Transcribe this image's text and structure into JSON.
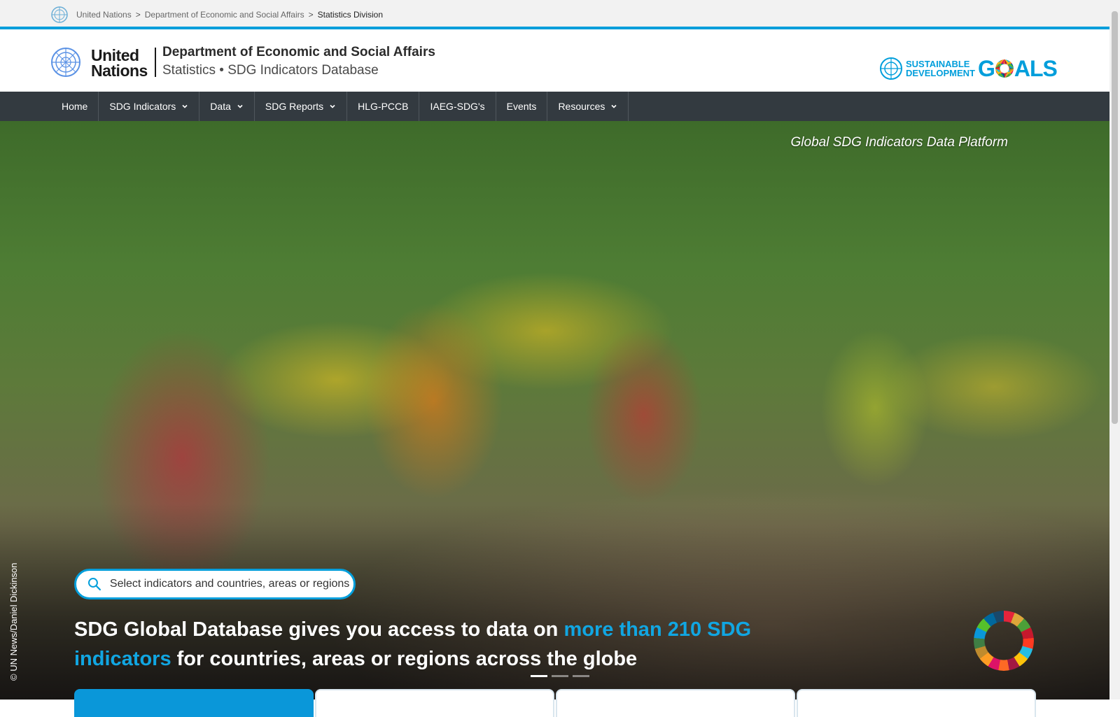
{
  "breadcrumb": {
    "items": [
      "United Nations",
      "Department of Economic and Social Affairs"
    ],
    "current": "Statistics Division",
    "separator": ">"
  },
  "header": {
    "un_word_line1": "United",
    "un_word_line2": "Nations",
    "dept_title": "Department of Economic and Social Affairs",
    "dept_subtitle": "Statistics • SDG Indicators Database",
    "sdg_logo": {
      "line1": "SUSTAINABLE",
      "line2": "DEVELOPMENT",
      "goals_g": "G",
      "goals_rest": "ALS"
    }
  },
  "nav": {
    "items": [
      {
        "label": "Home",
        "dropdown": false
      },
      {
        "label": "SDG Indicators",
        "dropdown": true
      },
      {
        "label": "Data",
        "dropdown": true
      },
      {
        "label": "SDG Reports",
        "dropdown": true
      },
      {
        "label": "HLG-PCCB",
        "dropdown": false
      },
      {
        "label": "IAEG-SDG's",
        "dropdown": false
      },
      {
        "label": "Events",
        "dropdown": false
      },
      {
        "label": "Resources",
        "dropdown": true
      }
    ]
  },
  "hero": {
    "platform_label": "Global SDG Indicators Data Platform",
    "photo_credit": "© UN News/Daniel Dickinson",
    "search": {
      "placeholder": "Select indicators and countries, areas or regions"
    },
    "headline": {
      "part1": "SDG Global Database gives you access to data on ",
      "highlight": "more than 210 SDG indicators",
      "part2": " for countries, areas or regions across the globe"
    },
    "carousel_active_index": 0,
    "carousel_count": 3
  },
  "colors": {
    "accent": "#009edb",
    "nav_bg": "#333a40",
    "highlight_text": "#11a6e2"
  },
  "icons": {
    "search": "search-icon",
    "chevron": "chevron-down-icon",
    "un_emblem": "un-emblem-icon",
    "sdg_wheel": "sdg-wheel-icon"
  }
}
